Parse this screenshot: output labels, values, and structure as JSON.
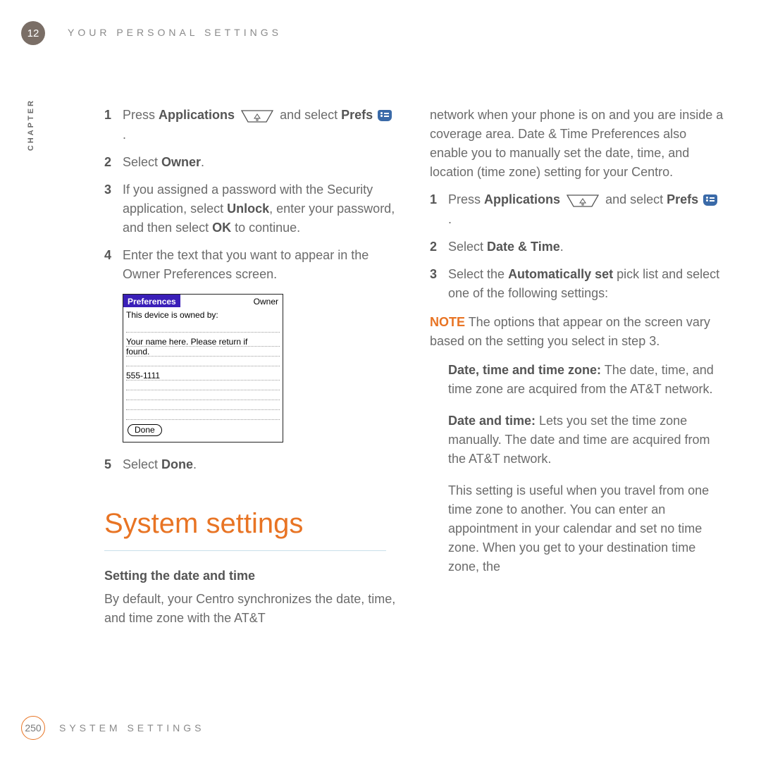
{
  "chapter_number": "12",
  "header_title": "YOUR PERSONAL SETTINGS",
  "chapter_label": "CHAPTER",
  "left": {
    "steps": [
      {
        "num": "1",
        "pre": "Press ",
        "bold1": "Applications",
        "mid": " and select ",
        "bold2": "Prefs",
        "post": " ."
      },
      {
        "num": "2",
        "pre": "Select ",
        "bold1": "Owner",
        "post": "."
      },
      {
        "num": "3",
        "text_a": "If you assigned a password with the Security application, select ",
        "bold_a": "Unlock",
        "text_b": ", enter your password, and then select ",
        "bold_b": "OK",
        "text_c": " to continue."
      },
      {
        "num": "4",
        "text_a": "Enter the text that you want to appear in the Owner Preferences screen."
      },
      {
        "num": "5",
        "pre": "Select ",
        "bold1": "Done",
        "post": "."
      }
    ],
    "section_heading": "System settings",
    "sub_heading": "Setting the date and time",
    "intro": "By default, your Centro synchronizes the date, time, and time zone with the AT&T"
  },
  "palm": {
    "title_left": "Preferences",
    "title_right": "Owner",
    "label": "This device is owned by:",
    "line2": "Your name here.  Please return if",
    "line3": "found.",
    "phone": "555-1111",
    "done": "Done"
  },
  "right": {
    "intro": "network when your phone is on and you are inside a coverage area. Date & Time Preferences also enable you to manually set the date, time, and location (time zone) setting for your Centro.",
    "steps": [
      {
        "num": "1",
        "pre": "Press ",
        "bold1": "Applications",
        "mid": " and select ",
        "bold2": "Prefs",
        "post": " ."
      },
      {
        "num": "2",
        "pre": "Select ",
        "bold1": "Date & Time",
        "post": "."
      },
      {
        "num": "3",
        "pre": "Select the ",
        "bold1": "Automatically set",
        "post": " pick list and select one of the following settings:"
      }
    ],
    "note_label": "NOTE",
    "note_text": " The options that appear on the screen vary based on the setting you select in step 3.",
    "opts": [
      {
        "bold": "Date, time and time zone:",
        "text": " The date, time, and time zone are acquired from the AT&T network."
      },
      {
        "bold": "Date and time:",
        "text": " Lets you set the time zone manually. The date and time are acquired from the AT&T network."
      }
    ],
    "tail": "This setting is useful when you travel from one time zone to another. You can enter an appointment in your calendar and set no time zone. When you get to your destination time zone, the"
  },
  "footer": {
    "page": "250",
    "title": "SYSTEM SETTINGS"
  }
}
